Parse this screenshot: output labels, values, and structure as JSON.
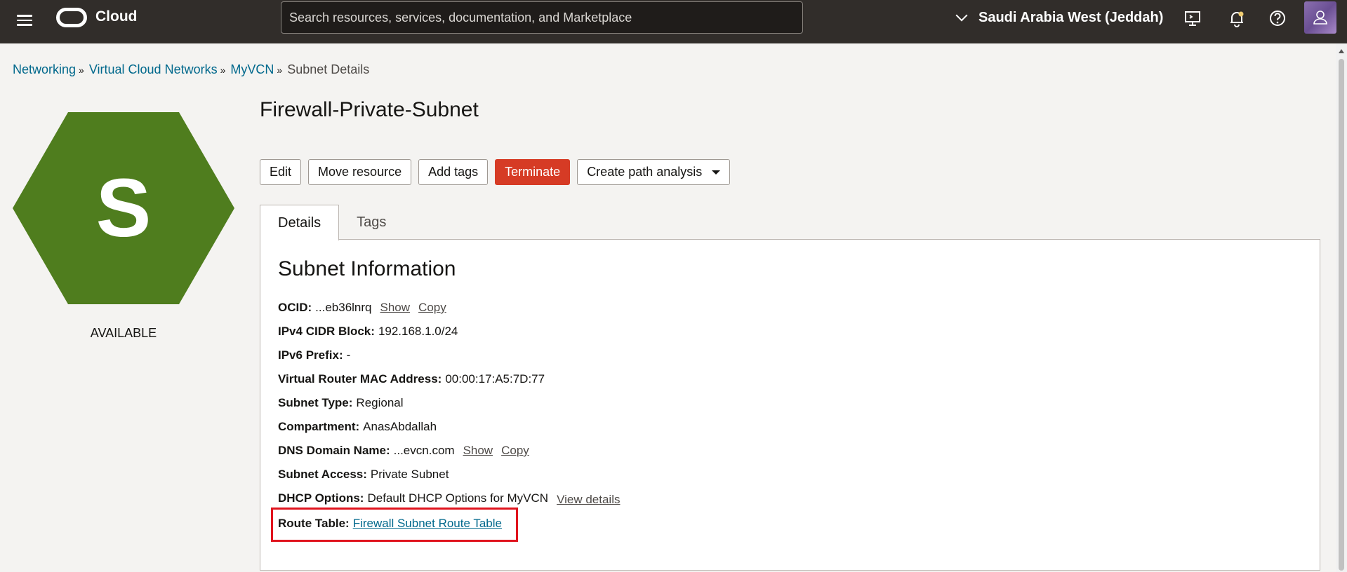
{
  "topbar": {
    "brand": "Cloud",
    "search_placeholder": "Search resources, services, documentation, and Marketplace",
    "region": "Saudi Arabia West (Jeddah)"
  },
  "breadcrumb": [
    {
      "label": "Networking"
    },
    {
      "label": "Virtual Cloud Networks"
    },
    {
      "label": "MyVCN"
    },
    {
      "label": "Subnet Details"
    }
  ],
  "resource": {
    "icon_letter": "S",
    "status": "AVAILABLE",
    "title": "Firewall-Private-Subnet"
  },
  "actions": {
    "edit": "Edit",
    "move": "Move resource",
    "add_tags": "Add tags",
    "terminate": "Terminate",
    "path_analysis": "Create path analysis"
  },
  "tabs": [
    "Details",
    "Tags"
  ],
  "info": {
    "heading": "Subnet Information",
    "ocid_label": "OCID:",
    "ocid_value": "...eb36lnrq",
    "show": "Show",
    "copy": "Copy",
    "cidr_label": "IPv4 CIDR Block:",
    "cidr_value": "192.168.1.0/24",
    "ipv6_label": "IPv6 Prefix:",
    "ipv6_value": "-",
    "mac_label": "Virtual Router MAC Address:",
    "mac_value": "00:00:17:A5:7D:77",
    "type_label": "Subnet Type:",
    "type_value": "Regional",
    "compartment_label": "Compartment:",
    "compartment_value": "AnasAbdallah",
    "dns_label": "DNS Domain Name:",
    "dns_value": "...evcn.com",
    "access_label": "Subnet Access:",
    "access_value": "Private Subnet",
    "dhcp_label": "DHCP Options:",
    "dhcp_value": "Default DHCP Options for MyVCN",
    "view_details": "View details",
    "route_label": "Route Table:",
    "route_value": "Firewall Subnet Route Table"
  },
  "colors": {
    "topbar": "#312d2a",
    "hexagon": "#4f7d1e",
    "terminate": "#d63b25",
    "link": "#00688c",
    "highlight": "#e0141e"
  }
}
